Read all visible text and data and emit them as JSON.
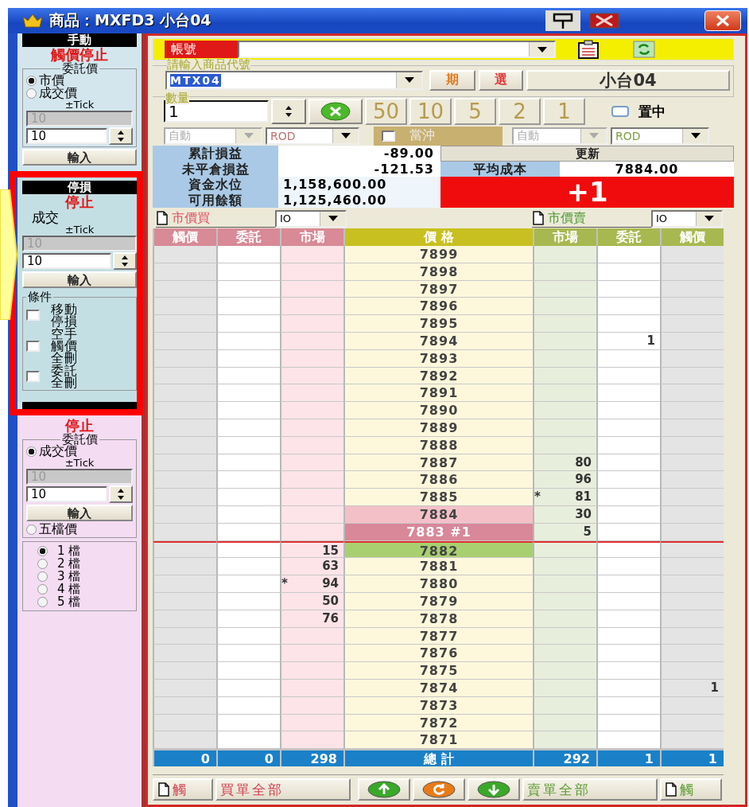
{
  "window": {
    "title": "商品：MXFD3 小台04"
  },
  "left_panel": {
    "manual": {
      "header": "手動",
      "status": "觸價停止",
      "group_label": "委託價",
      "price_modes": [
        {
          "label": "市價",
          "selected": true
        },
        {
          "label": "成交價",
          "selected": false
        }
      ],
      "tick_label": "±Tick",
      "disabled_value": "10",
      "tick_value": "10",
      "submit": "輸入"
    },
    "stop_loss": {
      "header": "停損",
      "status": "停止",
      "price_label": "成交",
      "tick_label": "±Tick",
      "disabled_value": "10",
      "tick_value": "10",
      "submit": "輸入",
      "conditions_label": "條件",
      "conditions": [
        {
          "label": "移動停損",
          "checked": false
        },
        {
          "label": "空手觸價全刪",
          "checked": false
        },
        {
          "label": "委託全刪",
          "checked": false
        }
      ]
    },
    "take_profit": {
      "status": "停止",
      "group_label": "委託價",
      "price_modes": [
        {
          "label": "成交價",
          "selected": true
        },
        {
          "label": "五檔價",
          "selected": false
        }
      ],
      "tick_label": "±Tick",
      "disabled_value": "10",
      "tick_value": "10",
      "submit": "輸入",
      "levels": [
        {
          "label": "1 檔",
          "selected": true
        },
        {
          "label": "2 檔",
          "selected": false
        },
        {
          "label": "3 檔",
          "selected": false
        },
        {
          "label": "4 檔",
          "selected": false
        },
        {
          "label": "5 檔",
          "selected": false
        }
      ]
    }
  },
  "account": {
    "label": "帳號"
  },
  "product": {
    "legend": "請輸入商品代號",
    "code": "MTX04",
    "futures": "期",
    "options": "選",
    "name": "小台04"
  },
  "quantity": {
    "legend": "數量",
    "value": "1",
    "presets": [
      "50",
      "10",
      "5",
      "2",
      "1"
    ],
    "center": {
      "label": "置中",
      "checked": false
    }
  },
  "order_options": {
    "buy_condition": "自動",
    "buy_tif": "ROD",
    "day_trade": {
      "label": "當沖",
      "checked": false
    },
    "sell_condition": "自動",
    "sell_tif": "ROD"
  },
  "summary": {
    "rows": [
      {
        "label": "累計損益",
        "value": "-89.00"
      },
      {
        "label": "未平倉損益",
        "value": "-121.53"
      },
      {
        "label": "資金水位",
        "value": "1,158,600.00"
      },
      {
        "label": "可用餘額",
        "value": "1,125,460.00"
      }
    ],
    "refresh": "更新",
    "avg_cost_label": "平均成本",
    "avg_cost": "7884.00",
    "position": "+1"
  },
  "market_orders": {
    "buy_label": "市價買",
    "buy_tif": "IO",
    "sell_label": "市價賣",
    "sell_tif": "IO"
  },
  "ladder": {
    "columns": [
      "觸價",
      "委託",
      "市場",
      "價 格",
      "市場",
      "委託",
      "觸價"
    ],
    "rows": [
      {
        "kind": "level",
        "price": "7899"
      },
      {
        "kind": "level",
        "price": "7898"
      },
      {
        "kind": "level",
        "price": "7897"
      },
      {
        "kind": "level",
        "price": "7896"
      },
      {
        "kind": "level",
        "price": "7895"
      },
      {
        "kind": "level",
        "price": "7894",
        "sell_order": "1"
      },
      {
        "kind": "level",
        "price": "7893"
      },
      {
        "kind": "level",
        "price": "7892"
      },
      {
        "kind": "level",
        "price": "7891"
      },
      {
        "kind": "level",
        "price": "7890"
      },
      {
        "kind": "level",
        "price": "7889"
      },
      {
        "kind": "level",
        "price": "7888"
      },
      {
        "kind": "level",
        "price": "7887",
        "sell_market": "80"
      },
      {
        "kind": "level",
        "price": "7886",
        "sell_market": "96"
      },
      {
        "kind": "level",
        "price": "7885",
        "sell_flag": "*",
        "sell_market": "81"
      },
      {
        "kind": "ask",
        "price": "7884",
        "sell_market": "30"
      },
      {
        "kind": "cost",
        "price": "7883 #1",
        "sell_market": "5"
      },
      {
        "kind": "bid",
        "price": "7882",
        "buy_market": "15"
      },
      {
        "kind": "level",
        "price": "7881",
        "buy_market": "63"
      },
      {
        "kind": "level",
        "price": "7880",
        "buy_flag": "*",
        "buy_market": "94"
      },
      {
        "kind": "level",
        "price": "7879",
        "buy_market": "50"
      },
      {
        "kind": "level",
        "price": "7878",
        "buy_market": "76"
      },
      {
        "kind": "level",
        "price": "7877"
      },
      {
        "kind": "level",
        "price": "7876"
      },
      {
        "kind": "level",
        "price": "7875"
      },
      {
        "kind": "level",
        "price": "7874",
        "sell_touch": "1"
      },
      {
        "kind": "level",
        "price": "7873"
      },
      {
        "kind": "level",
        "price": "7872"
      },
      {
        "kind": "level",
        "price": "7871"
      }
    ],
    "totals": [
      "0",
      "0",
      "298",
      "總 計",
      "292",
      "1",
      "1"
    ]
  },
  "bottom_bar": {
    "buy_touch": "觸",
    "buy_cancel_all": "買單全部",
    "sell_cancel_all": "賣單全部",
    "sell_touch": "觸"
  }
}
